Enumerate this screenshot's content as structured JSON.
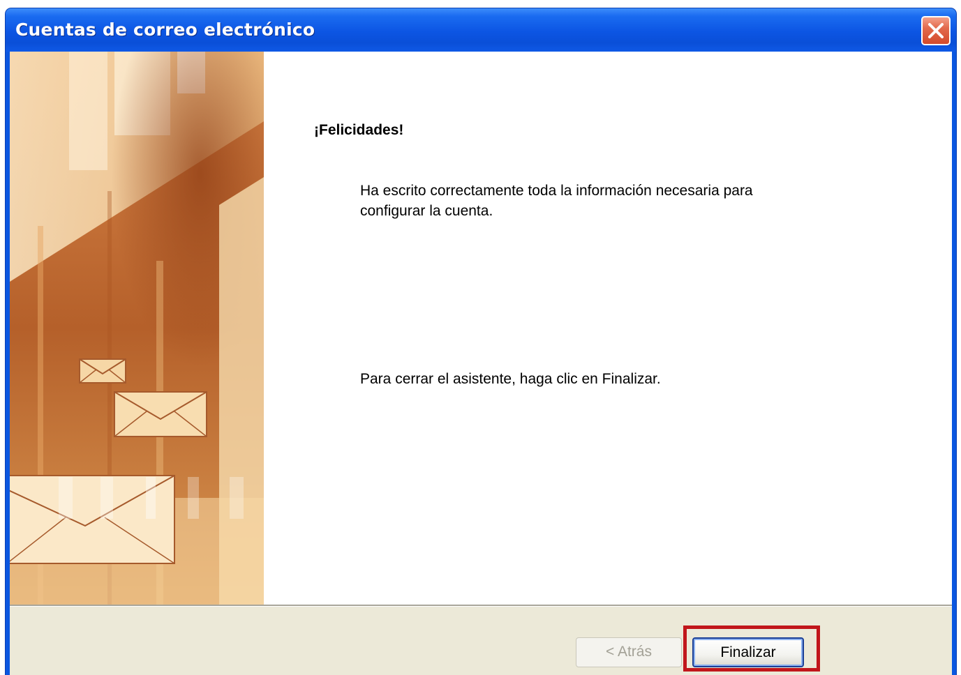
{
  "window": {
    "title": "Cuentas de correo electrónico"
  },
  "content": {
    "heading": "¡Felicidades!",
    "paragraph1_line1": "Ha escrito correctamente toda la información necesaria para",
    "paragraph1_line2": "configurar la cuenta.",
    "paragraph2": "Para cerrar el asistente, haga clic en Finalizar."
  },
  "buttons": {
    "back_label": "< Atrás",
    "finish_label": "Finalizar"
  },
  "colors": {
    "titlebar_blue": "#0a56e0",
    "highlight_red": "#c1161b",
    "footer_bg": "#ece9d8"
  },
  "icons": {
    "close": "close-icon",
    "banner": "envelope-icon"
  }
}
